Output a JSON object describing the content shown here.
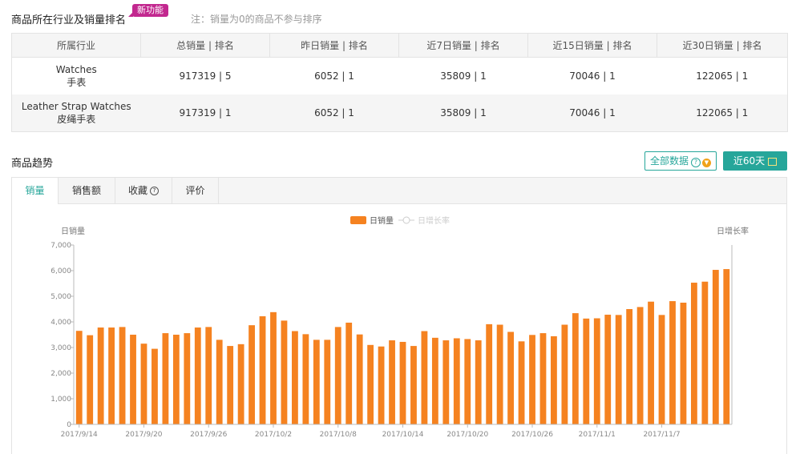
{
  "ranking": {
    "title": "商品所在行业及销量排名",
    "badge": "新功能",
    "note": "注：销量为0的商品不参与排序",
    "headers": [
      "所属行业",
      "总销量 | 排名",
      "昨日销量 | 排名",
      "近7日销量 | 排名",
      "近15日销量 | 排名",
      "近30日销量 | 排名"
    ],
    "rows": [
      {
        "industry_en": "Watches",
        "industry_cn": "手表",
        "cells": [
          "917319 | 5",
          "6052 | 1",
          "35809 | 1",
          "70046 | 1",
          "122065 | 1"
        ]
      },
      {
        "industry_en": "Leather Strap Watches",
        "industry_cn": "皮绳手表",
        "cells": [
          "917319 | 1",
          "6052 | 1",
          "35809 | 1",
          "70046 | 1",
          "122065 | 1"
        ]
      }
    ]
  },
  "trend": {
    "title": "商品趋势",
    "all_data_button": "全部数据",
    "range_button": "近60天",
    "tabs": [
      "销量",
      "销售额",
      "收藏",
      "评价"
    ],
    "active_tab": 0
  },
  "colors": {
    "accent": "#26a69a",
    "bar": "#f58220",
    "badge": "#c2288f"
  },
  "chart_data": {
    "type": "bar",
    "legend": [
      "日销量",
      "日增长率"
    ],
    "ylabel_left": "日销量",
    "ylabel_right": "日增长率",
    "ylim": [
      0,
      7000
    ],
    "yticks": [
      "0",
      "1,000",
      "2,000",
      "3,000",
      "4,000",
      "5,000",
      "6,000",
      "7,000"
    ],
    "xtick_labels": [
      "2017/9/14",
      "2017/9/20",
      "2017/9/26",
      "2017/10/2",
      "2017/10/8",
      "2017/10/14",
      "2017/10/20",
      "2017/10/26",
      "2017/11/1",
      "2017/11/7"
    ],
    "categories": [
      "2017/9/14",
      "2017/9/15",
      "2017/9/16",
      "2017/9/17",
      "2017/9/18",
      "2017/9/19",
      "2017/9/20",
      "2017/9/21",
      "2017/9/22",
      "2017/9/23",
      "2017/9/24",
      "2017/9/25",
      "2017/9/26",
      "2017/9/27",
      "2017/9/28",
      "2017/9/29",
      "2017/9/30",
      "2017/10/1",
      "2017/10/2",
      "2017/10/3",
      "2017/10/4",
      "2017/10/5",
      "2017/10/6",
      "2017/10/7",
      "2017/10/8",
      "2017/10/9",
      "2017/10/10",
      "2017/10/11",
      "2017/10/12",
      "2017/10/13",
      "2017/10/14",
      "2017/10/15",
      "2017/10/16",
      "2017/10/17",
      "2017/10/18",
      "2017/10/19",
      "2017/10/20",
      "2017/10/21",
      "2017/10/22",
      "2017/10/23",
      "2017/10/24",
      "2017/10/25",
      "2017/10/26",
      "2017/10/27",
      "2017/10/28",
      "2017/10/29",
      "2017/10/30",
      "2017/10/31",
      "2017/11/1",
      "2017/11/2",
      "2017/11/3",
      "2017/11/4",
      "2017/11/5",
      "2017/11/6",
      "2017/11/7",
      "2017/11/8",
      "2017/11/9",
      "2017/11/10",
      "2017/11/11",
      "2017/11/12",
      "2017/11/13"
    ],
    "series": [
      {
        "name": "日销量",
        "values": [
          3650,
          3480,
          3780,
          3780,
          3800,
          3500,
          3150,
          2950,
          3560,
          3500,
          3560,
          3780,
          3800,
          3300,
          3060,
          3130,
          3870,
          4220,
          4380,
          4050,
          3640,
          3520,
          3300,
          3300,
          3800,
          3970,
          3510,
          3100,
          3040,
          3280,
          3220,
          3060,
          3640,
          3380,
          3280,
          3360,
          3330,
          3280,
          3910,
          3890,
          3610,
          3240,
          3490,
          3560,
          3440,
          3890,
          4340,
          4130,
          4140,
          4280,
          4270,
          4500,
          4580,
          4790,
          4270,
          4810,
          4750,
          5530,
          5570,
          6030,
          6060
        ]
      }
    ]
  }
}
